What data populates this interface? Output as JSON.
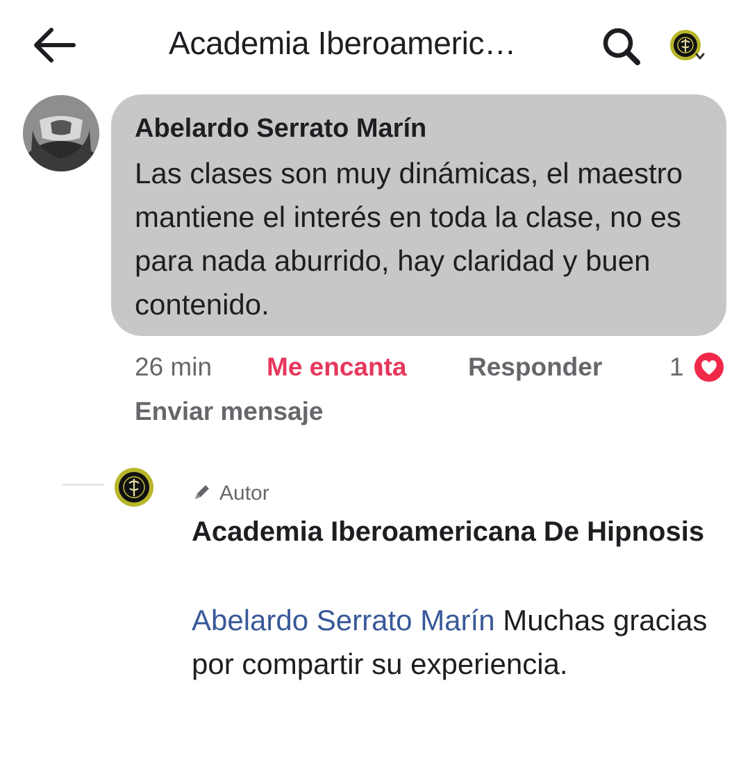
{
  "header": {
    "title": "Academia Iberoameric…",
    "back_icon": "arrow-left-icon",
    "search_icon": "search-icon",
    "profile_icon": "page-profile-icon"
  },
  "comment": {
    "author": "Abelardo Serrato Marín",
    "text": "Las clases son muy dinámicas, el maestro mantiene el interés en toda la clase, no es para nada aburrido, hay claridad y buen contenido.",
    "time": "26 min",
    "reaction_label": "Me encanta",
    "reply_label": "Responder",
    "message_label": "Enviar mensaje",
    "reaction_count": "1",
    "reaction_icon": "heart-icon",
    "colors": {
      "bubble": "#c7c7c7",
      "love": "#e6375c",
      "meta": "#65676b"
    }
  },
  "reply": {
    "badge_icon": "pencil-icon",
    "badge": "Autor",
    "author": "Academia Iberoamericana De Hipnosis",
    "mention": "Abelardo Serrato Marín",
    "text": " Muchas gracias por compartir su experiencia.",
    "colors": {
      "mention": "#385898"
    }
  }
}
